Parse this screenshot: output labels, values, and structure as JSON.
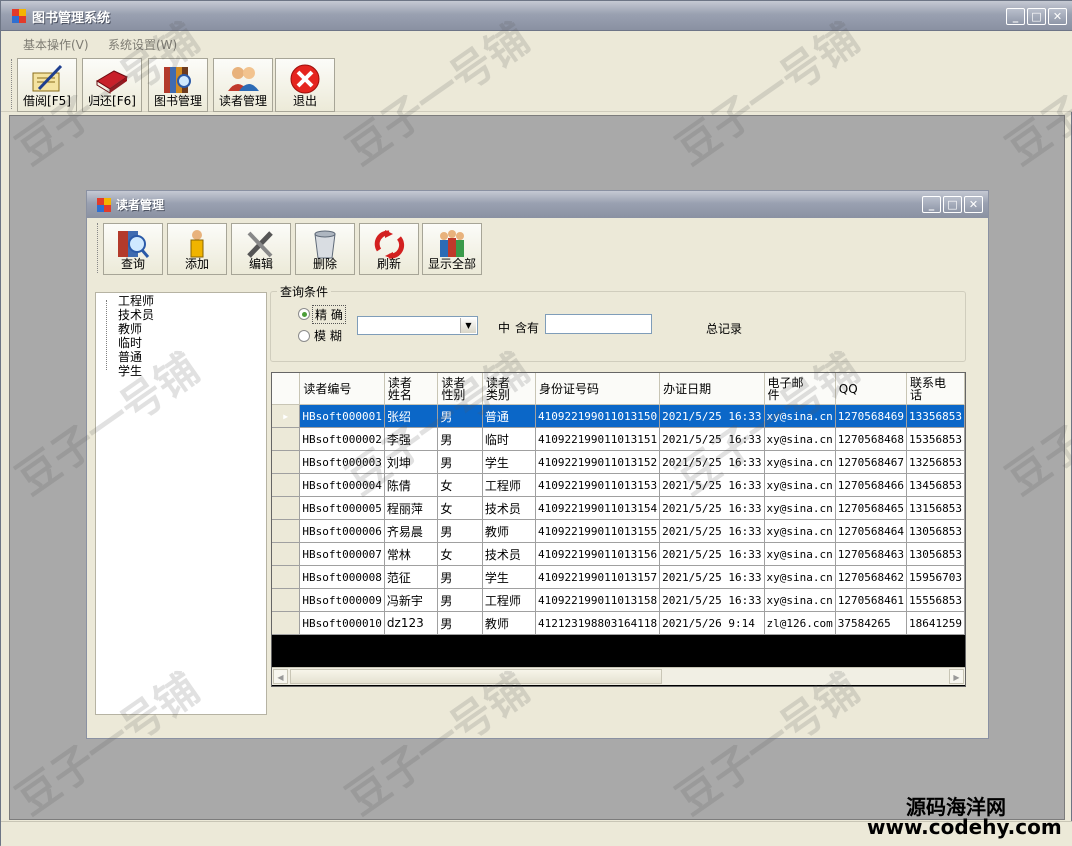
{
  "app": {
    "title": "图书管理系统"
  },
  "menu": [
    "基本操作(V)",
    "系统设置(W)"
  ],
  "toolbar": [
    {
      "label": "借阅[F5]",
      "icon": "borrow-icon"
    },
    {
      "label": "归还[F6]",
      "icon": "return-book-icon"
    },
    {
      "label": "图书管理",
      "icon": "book-manage-icon"
    },
    {
      "label": "读者管理",
      "icon": "reader-manage-icon"
    },
    {
      "label": "退出",
      "icon": "exit-icon"
    }
  ],
  "child": {
    "title": "读者管理",
    "toolbar": [
      {
        "label": "查询",
        "icon": "query-icon"
      },
      {
        "label": "添加",
        "icon": "add-icon"
      },
      {
        "label": "编辑",
        "icon": "edit-icon"
      },
      {
        "label": "删除",
        "icon": "delete-icon"
      },
      {
        "label": "刷新",
        "icon": "refresh-icon"
      },
      {
        "label": "显示全部",
        "icon": "show-all-icon"
      }
    ],
    "tree": [
      "工程师",
      "技术员",
      "教师",
      "临时",
      "普通",
      "学生"
    ],
    "query": {
      "legend": "查询条件",
      "exact": "精 确",
      "fuzzy": "模 糊",
      "contains_prefix": "中",
      "contains_label": "含有",
      "contains_value": "",
      "total_label": "总记录"
    },
    "grid": {
      "columns": [
        "读者编号",
        "读者\n姓名",
        "读者\n性别",
        "读者\n类别",
        "身份证号码",
        "办证日期",
        "电子邮\n件",
        "QQ",
        "联系电\n话"
      ],
      "rows": [
        [
          "HBsoft000001",
          "张绍",
          "男",
          "普通",
          "410922199011013150",
          "2021/5/25 16:33",
          "xy@sina.cn",
          "1270568469",
          "13356853"
        ],
        [
          "HBsoft000002",
          "李强",
          "男",
          "临时",
          "410922199011013151",
          "2021/5/25 16:33",
          "xy@sina.cn",
          "1270568468",
          "15356853"
        ],
        [
          "HBsoft000003",
          "刘坤",
          "男",
          "学生",
          "410922199011013152",
          "2021/5/25 16:33",
          "xy@sina.cn",
          "1270568467",
          "13256853"
        ],
        [
          "HBsoft000004",
          "陈倩",
          "女",
          "工程师",
          "410922199011013153",
          "2021/5/25 16:33",
          "xy@sina.cn",
          "1270568466",
          "13456853"
        ],
        [
          "HBsoft000005",
          "程丽萍",
          "女",
          "技术员",
          "410922199011013154",
          "2021/5/25 16:33",
          "xy@sina.cn",
          "1270568465",
          "13156853"
        ],
        [
          "HBsoft000006",
          "齐易晨",
          "男",
          "教师",
          "410922199011013155",
          "2021/5/25 16:33",
          "xy@sina.cn",
          "1270568464",
          "13056853"
        ],
        [
          "HBsoft000007",
          "常林",
          "女",
          "技术员",
          "410922199011013156",
          "2021/5/25 16:33",
          "xy@sina.cn",
          "1270568463",
          "13056853"
        ],
        [
          "HBsoft000008",
          "范征",
          "男",
          "学生",
          "410922199011013157",
          "2021/5/25 16:33",
          "xy@sina.cn",
          "1270568462",
          "15956703"
        ],
        [
          "HBsoft000009",
          "冯新宇",
          "男",
          "工程师",
          "410922199011013158",
          "2021/5/25 16:33",
          "xy@sina.cn",
          "1270568461",
          "15556853"
        ],
        [
          "HBsoft000010",
          "dz123",
          "男",
          "教师",
          "412123198803164118",
          "2021/5/26 9:14",
          "zl@126.com",
          "37584265",
          "18641259"
        ]
      ]
    }
  },
  "watermark": {
    "brand": "豆子一号铺",
    "site_cn": "源码海洋网",
    "site_url": "www.codehy.com"
  }
}
